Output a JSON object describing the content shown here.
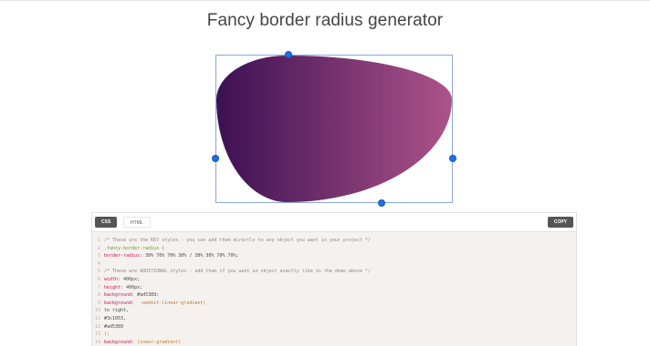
{
  "page": {
    "title": "Fancy border radius generator"
  },
  "shape": {
    "border_radius": "30% 70% 70% 30% / 30% 30% 70% 70%",
    "gradient_from": "#3c1053",
    "gradient_to": "#ad5389",
    "handle_color": "#1f6fe0"
  },
  "editor": {
    "tabs": [
      {
        "label": "CSS",
        "active": true
      },
      {
        "label": "HTML",
        "active": false
      }
    ],
    "copy_label": "COPY",
    "lines": [
      {
        "n": "1",
        "parts": [
          {
            "t": "/* These are the KEY styles - you can add them directly to any object you want in your project */",
            "c": "comment"
          }
        ]
      },
      {
        "n": "2",
        "parts": [
          {
            "t": ".fancy-border-radius {",
            "c": "selector"
          }
        ]
      },
      {
        "n": "3",
        "parts": [
          {
            "t": "border-radius:",
            "c": "prop"
          },
          {
            "t": " 30% 70% 70% 30% / 30% 30% 70% 70%;",
            "c": "val"
          }
        ]
      },
      {
        "n": "4",
        "parts": []
      },
      {
        "n": "5",
        "parts": [
          {
            "t": "/* These are ADDITIONAL styles - add them if you want an object exactly like in the demo above */",
            "c": "comment"
          }
        ]
      },
      {
        "n": "6",
        "parts": [
          {
            "t": "width:",
            "c": "prop"
          },
          {
            "t": " 400px;",
            "c": "val"
          }
        ]
      },
      {
        "n": "7",
        "parts": [
          {
            "t": "height:",
            "c": "prop"
          },
          {
            "t": " 400px;",
            "c": "val"
          }
        ]
      },
      {
        "n": "8",
        "parts": [
          {
            "t": "background:",
            "c": "prop"
          },
          {
            "t": " #ad5389;",
            "c": "val"
          }
        ]
      },
      {
        "n": "9",
        "parts": [
          {
            "t": "background:",
            "c": "prop"
          },
          {
            "t": "  -webkit-linear-gradient(",
            "c": "fn"
          }
        ]
      },
      {
        "n": "10",
        "parts": [
          {
            "t": "to right,",
            "c": "val"
          }
        ]
      },
      {
        "n": "11",
        "parts": [
          {
            "t": "#3c1053,",
            "c": "val"
          }
        ]
      },
      {
        "n": "12",
        "parts": [
          {
            "t": "#ad5389",
            "c": "val"
          }
        ]
      },
      {
        "n": "13",
        "parts": [
          {
            "t": ");",
            "c": "fn"
          }
        ]
      },
      {
        "n": "14",
        "parts": [
          {
            "t": "background:",
            "c": "prop"
          },
          {
            "t": " linear-gradient(",
            "c": "fn"
          }
        ]
      }
    ]
  }
}
